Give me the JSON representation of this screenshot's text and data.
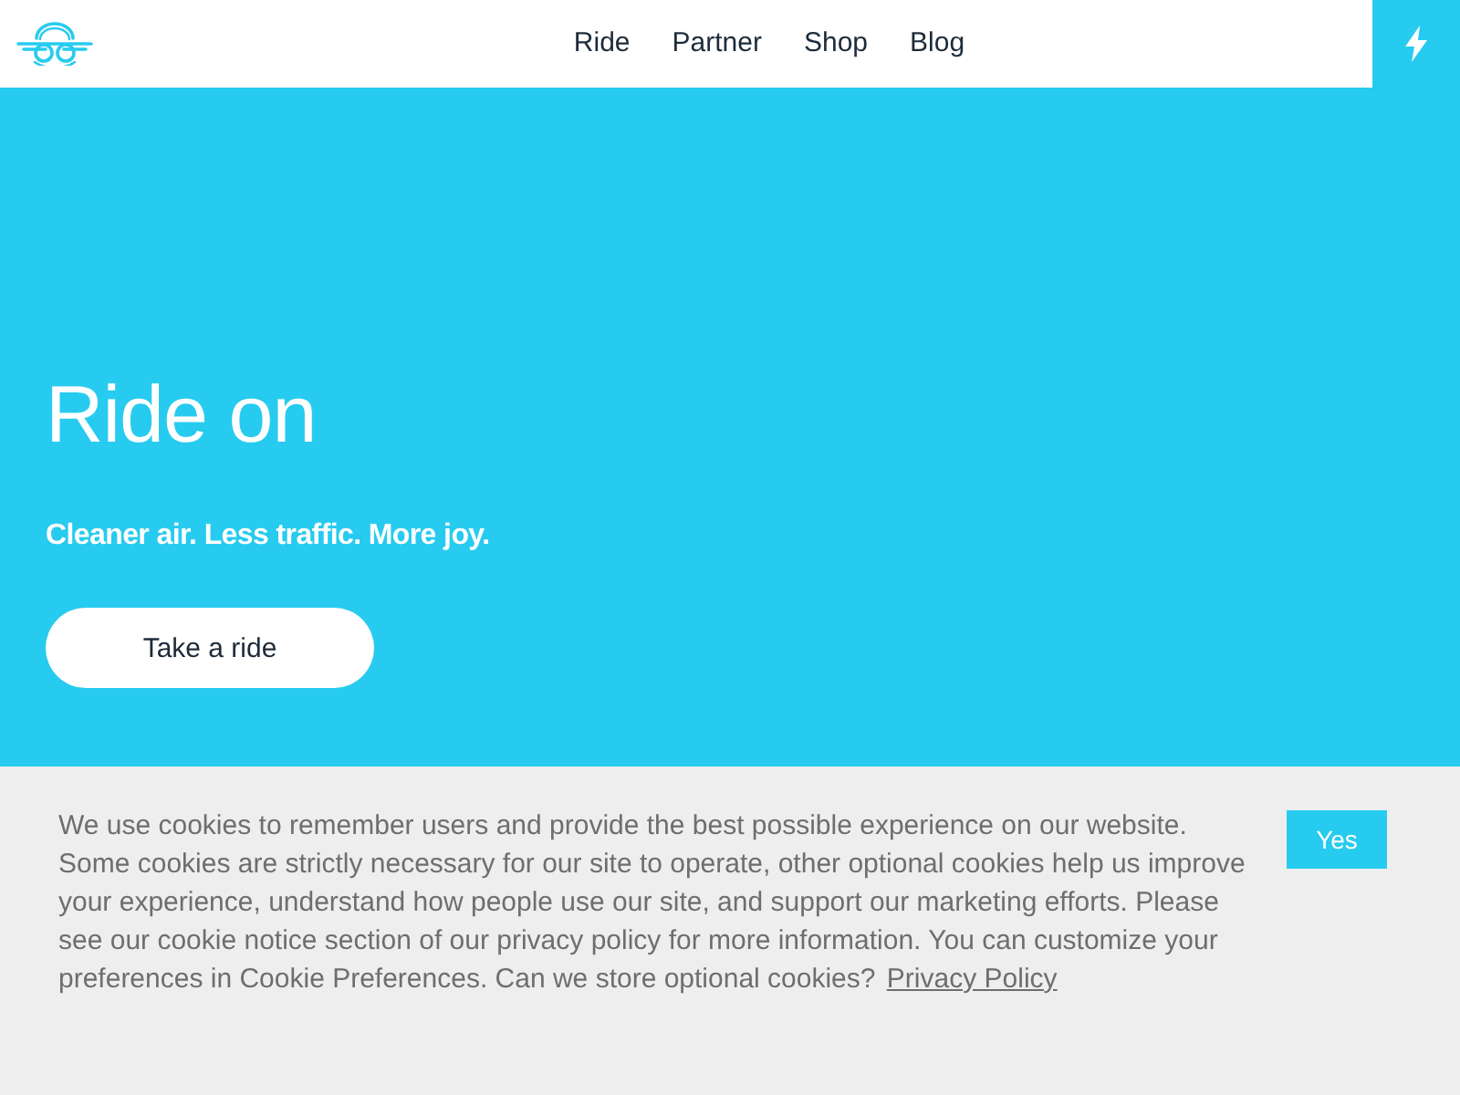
{
  "header": {
    "nav": [
      {
        "label": "Ride"
      },
      {
        "label": "Partner"
      },
      {
        "label": "Shop"
      },
      {
        "label": "Blog"
      }
    ]
  },
  "hero": {
    "title": "Ride on",
    "subtitle": "Cleaner air. Less traffic. More joy.",
    "button": "Take a ride"
  },
  "cookie_banner": {
    "text": "We use cookies to remember users and provide the best possible experience on our website. Some cookies are strictly necessary for our site to operate, other optional cookies help us improve your experience, understand how people use our site, and support our marketing efforts. Please see our cookie notice section of our privacy policy for more information. You can customize your preferences in Cookie Preferences. Can we store optional cookies?",
    "link": "Privacy Policy",
    "button": "Yes"
  }
}
